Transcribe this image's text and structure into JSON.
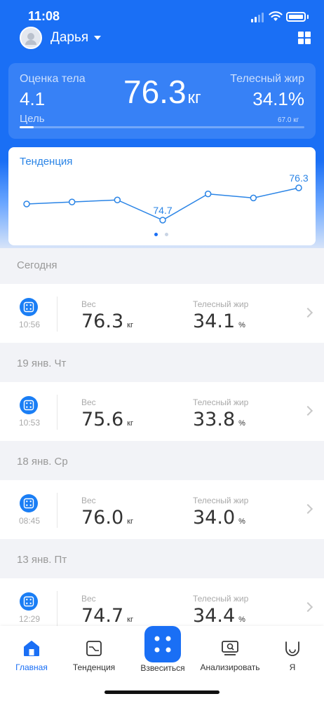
{
  "status_bar": {
    "time": "11:08"
  },
  "profile": {
    "name": "Дарья"
  },
  "summary": {
    "body_score_label": "Оценка тела",
    "body_score_value": "4.1",
    "weight_value": "76.3",
    "weight_unit": "кг",
    "body_fat_label": "Телесный жир",
    "body_fat_value": "34.1%",
    "goal_label": "Цель",
    "goal_target": "67.0 кг",
    "goal_progress": 0.05
  },
  "trend": {
    "title": "Тенденция",
    "points": [
      75.5,
      75.6,
      75.7,
      74.7,
      76.0,
      75.8,
      76.3
    ],
    "labeled_points": {
      "3": "74.7",
      "6": "76.3"
    },
    "page_count": 2,
    "active_page": 0
  },
  "sections": [
    {
      "header": "Сегодня",
      "record": {
        "time": "10:56",
        "weight_label": "Вес",
        "weight": "76.3",
        "weight_unit": "кг",
        "fat_label": "Телесный жир",
        "fat": "34.1",
        "fat_unit": "%"
      }
    },
    {
      "header": "19 янв. Чт",
      "record": {
        "time": "10:53",
        "weight_label": "Вес",
        "weight": "75.6",
        "weight_unit": "кг",
        "fat_label": "Телесный жир",
        "fat": "33.8",
        "fat_unit": "%"
      }
    },
    {
      "header": "18 янв. Ср",
      "record": {
        "time": "08:45",
        "weight_label": "Вес",
        "weight": "76.0",
        "weight_unit": "кг",
        "fat_label": "Телесный жир",
        "fat": "34.0",
        "fat_unit": "%"
      }
    },
    {
      "header": "13 янв. Пт",
      "record": {
        "time": "12:29",
        "weight_label": "Вес",
        "weight": "74.7",
        "weight_unit": "кг",
        "fat_label": "Телесный жир",
        "fat": "34.4",
        "fat_unit": "%"
      }
    }
  ],
  "tabbar": {
    "home": "Главная",
    "trend": "Тенденция",
    "weigh": "Взвеситься",
    "analyze": "Анализировать",
    "me": "Я"
  },
  "colors": {
    "accent": "#1a6ff5",
    "trend_line": "#2a84e6"
  }
}
